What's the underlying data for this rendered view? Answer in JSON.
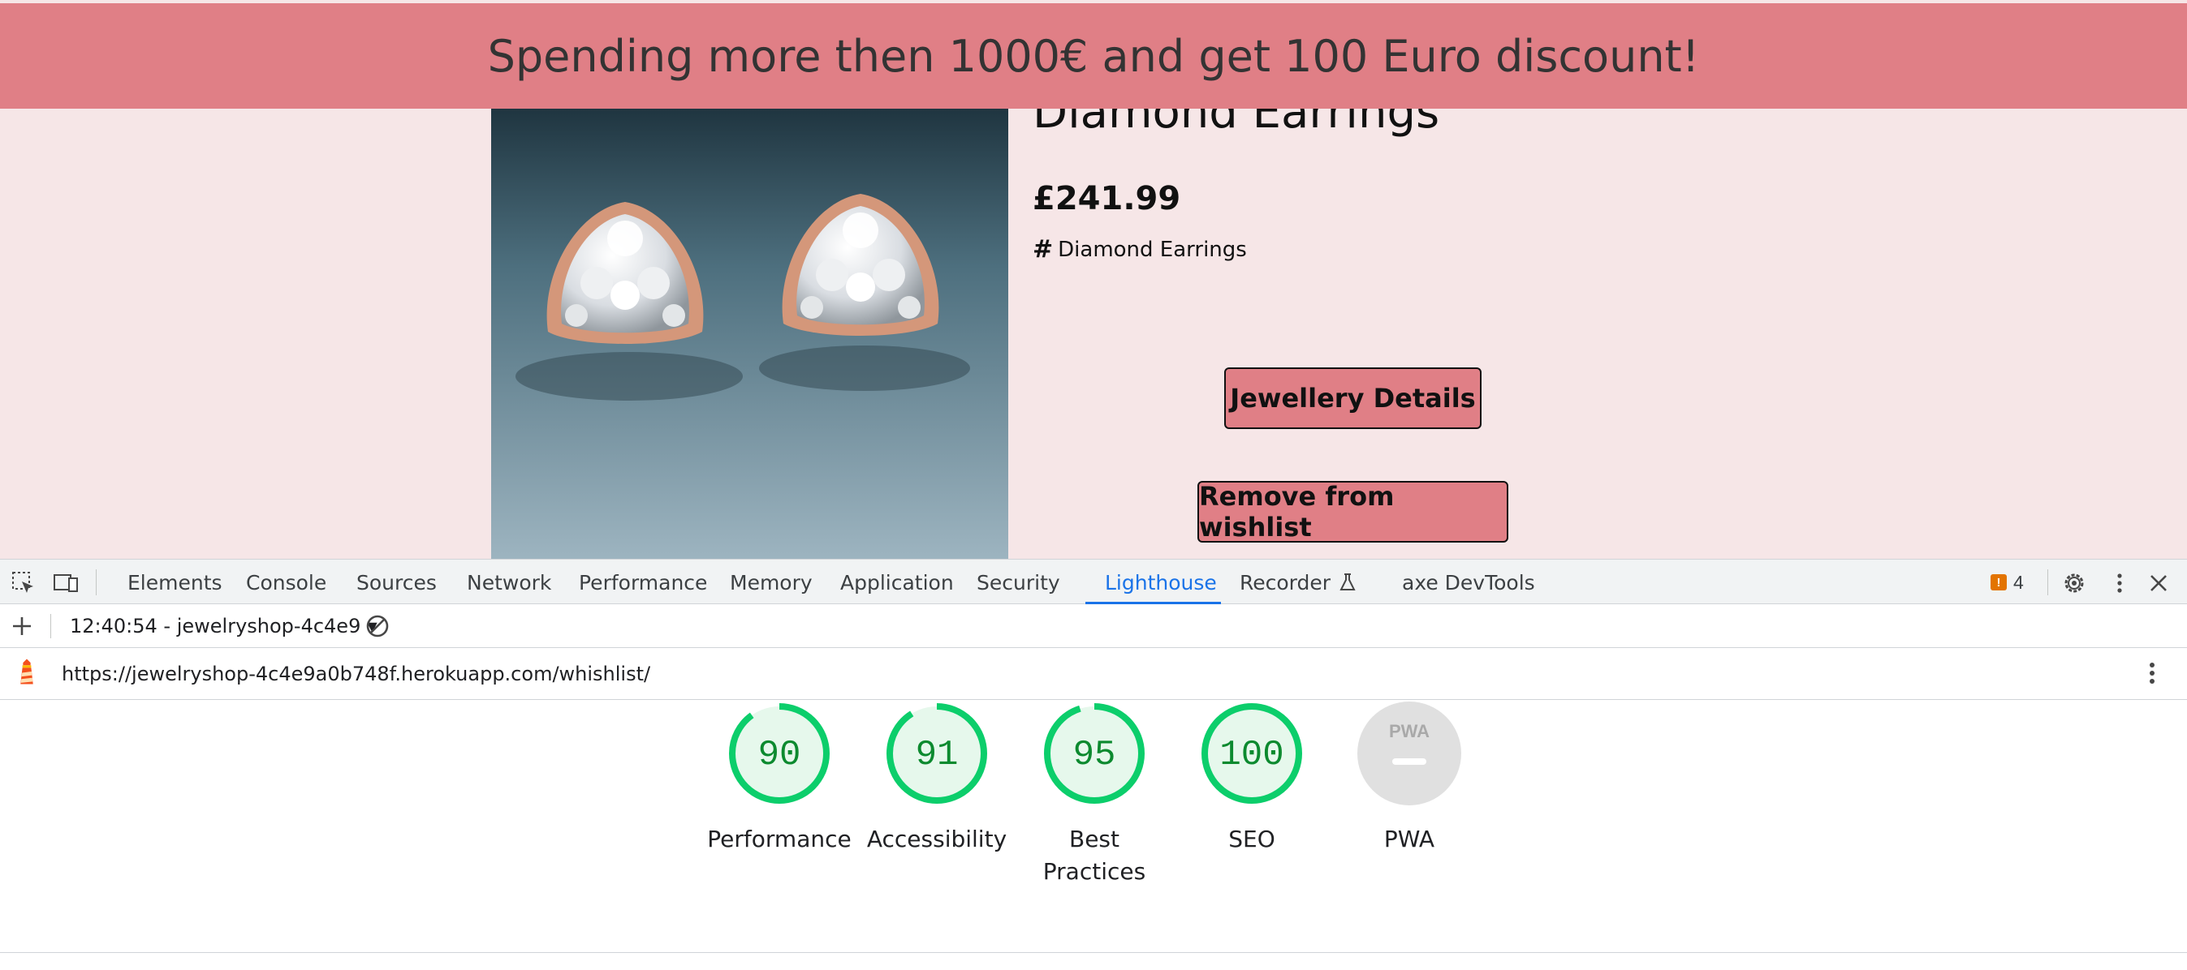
{
  "promo": {
    "text": "Spending more then 1000€ and get 100 Euro discount!"
  },
  "product": {
    "title": "Diamond Earrings",
    "price": "£241.99",
    "tag_symbol": "#",
    "tag": "Diamond Earrings",
    "details_button": "Jewellery Details",
    "remove_button": "Remove from wishlist"
  },
  "devtools": {
    "tabs": [
      {
        "label": "Elements"
      },
      {
        "label": "Console"
      },
      {
        "label": "Sources"
      },
      {
        "label": "Network"
      },
      {
        "label": "Performance"
      },
      {
        "label": "Memory"
      },
      {
        "label": "Application"
      },
      {
        "label": "Security"
      },
      {
        "label": "Lighthouse",
        "active": true
      },
      {
        "label": "Recorder"
      },
      {
        "label": "axe DevTools"
      }
    ],
    "issues_count": "4",
    "issues_badge": "!"
  },
  "lighthouse": {
    "report_select": "12:40:54 - jewelryshop-4c4e9",
    "url": "https://jewelryshop-4c4e9a0b748f.herokuapp.com/whishlist/",
    "scores": [
      {
        "score": 90,
        "label": "Performance"
      },
      {
        "score": 91,
        "label": "Accessibility"
      },
      {
        "score": 95,
        "label_line1": "Best",
        "label_line2": "Practices"
      },
      {
        "score": 100,
        "label": "SEO"
      }
    ],
    "pwa": {
      "badge_text": "PWA",
      "label": "PWA"
    },
    "colors": {
      "pass": "#0c8a2f",
      "pass_ring": "#0cce6b",
      "pass_fill": "#e6f8ec",
      "pwa_gray": "#e0e0e0"
    }
  }
}
